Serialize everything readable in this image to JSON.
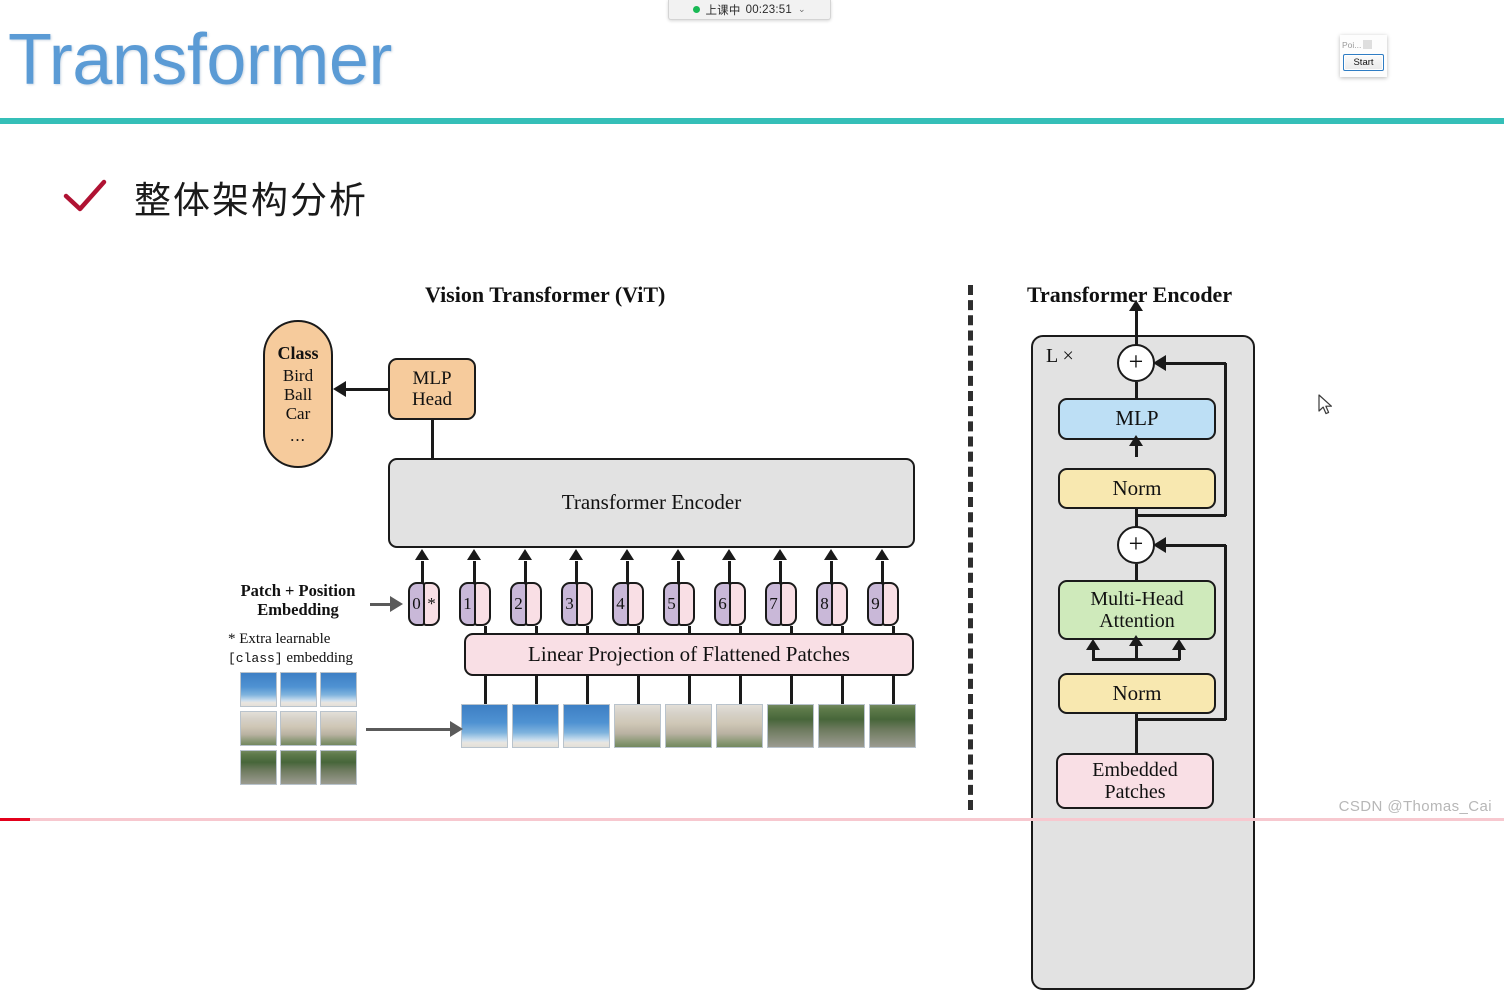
{
  "timer": {
    "status_label": "上课中",
    "elapsed": "00:23:51",
    "chevron": "⌄",
    "dot_color": "#19b955"
  },
  "recorder": {
    "field_text": "Poi...",
    "start_label": "Start"
  },
  "slide": {
    "title": "Transformer",
    "title_color": "#5b9bd5",
    "divider_color": "#35bfb8",
    "section_heading": "整体架构分析",
    "check_color": "#b01233"
  },
  "figure": {
    "vit_title": "Vision Transformer (ViT)",
    "encoder_title": "Transformer Encoder",
    "class_capsule": {
      "head": "Class",
      "items": [
        "Bird",
        "Ball",
        "Car"
      ],
      "ellipsis": "...",
      "color": "#f6cb9c"
    },
    "mlp_head": {
      "line1": "MLP",
      "line2": "Head",
      "color": "#f6cb9c"
    },
    "transformer_encoder_box": {
      "label": "Transformer Encoder",
      "color": "#e2e2e2"
    },
    "linear_projection": {
      "label": "Linear Projection of Flattened Patches",
      "color": "#f9dfe5"
    },
    "patch_pos_label": {
      "line1": "Patch + Position",
      "line2": "Embedding"
    },
    "extra_note": {
      "line1": "* Extra learnable",
      "mono": "[class]",
      "line2_tail": " embedding"
    },
    "tokens": [
      {
        "num": "0",
        "mark": "*"
      },
      {
        "num": "1",
        "mark": ""
      },
      {
        "num": "2",
        "mark": ""
      },
      {
        "num": "3",
        "mark": ""
      },
      {
        "num": "4",
        "mark": ""
      },
      {
        "num": "5",
        "mark": ""
      },
      {
        "num": "6",
        "mark": ""
      },
      {
        "num": "7",
        "mark": ""
      },
      {
        "num": "8",
        "mark": ""
      },
      {
        "num": "9",
        "mark": ""
      }
    ],
    "token_colors": {
      "position": "#c9b8d8",
      "patch": "#f9dfe5"
    },
    "encoder": {
      "repeat_label": "L ×",
      "panel_color": "#e2e2e2",
      "add1_symbol": "+",
      "add2_symbol": "+",
      "mlp": {
        "label": "MLP",
        "color": "#bddff5"
      },
      "norm_top": {
        "label": "Norm",
        "color": "#f8e8b0"
      },
      "mha": {
        "line1": "Multi-Head",
        "line2": "Attention",
        "color": "#cfeabb"
      },
      "norm_bottom": {
        "label": "Norm",
        "color": "#f8e8b0"
      },
      "embedded_patches": {
        "line1": "Embedded",
        "line2": "Patches",
        "color": "#f9dfe5"
      }
    }
  },
  "watermark": "CSDN @Thomas_Cai",
  "progress": {
    "track_color": "#f7c8cf",
    "fill_color": "#e3001b"
  }
}
